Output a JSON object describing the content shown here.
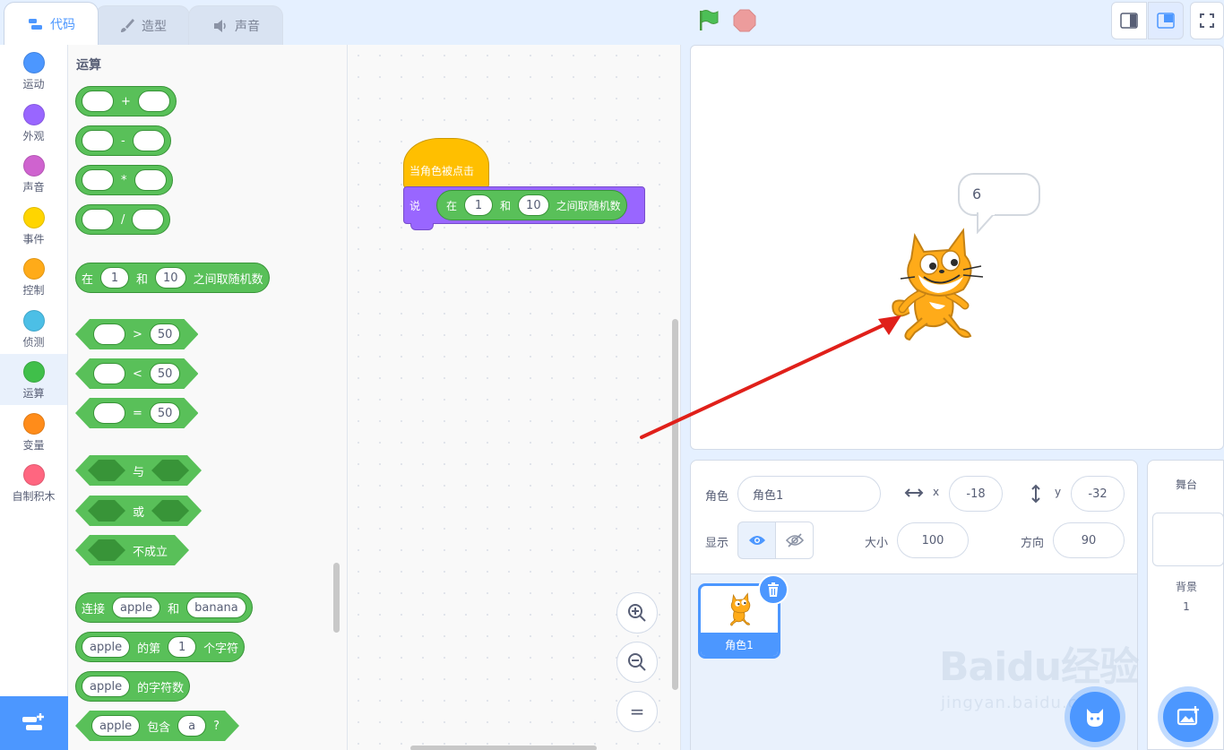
{
  "tabs": {
    "code": "代码",
    "costumes": "造型",
    "sounds": "声音"
  },
  "categories": [
    {
      "label": "运动",
      "color": "#4c97ff"
    },
    {
      "label": "外观",
      "color": "#9966ff"
    },
    {
      "label": "声音",
      "color": "#cf63cf"
    },
    {
      "label": "事件",
      "color": "#ffd500"
    },
    {
      "label": "控制",
      "color": "#ffab19"
    },
    {
      "label": "侦测",
      "color": "#4cbfe6"
    },
    {
      "label": "运算",
      "color": "#40bf4a"
    },
    {
      "label": "变量",
      "color": "#ff8c1a"
    },
    {
      "label": "自制积木",
      "color": "#ff6680"
    }
  ],
  "palette": {
    "title": "运算",
    "ops": [
      "+",
      "-",
      "*",
      "/"
    ],
    "random": {
      "p1": "在",
      "a": "1",
      "p2": "和",
      "b": "10",
      "p3": "之间取随机数"
    },
    "compare": [
      {
        "op": ">",
        "val": "50"
      },
      {
        "op": "<",
        "val": "50"
      },
      {
        "op": "=",
        "val": "50"
      }
    ],
    "logic": {
      "and": "与",
      "or": "或",
      "not": "不成立"
    },
    "join": {
      "p1": "连接",
      "a": "apple",
      "p2": "和",
      "b": "banana"
    },
    "letter": {
      "a": "apple",
      "p1": "的第",
      "n": "1",
      "p2": "个字符"
    },
    "length": {
      "a": "apple",
      "p1": "的字符数"
    },
    "contains": {
      "a": "apple",
      "p1": "包含",
      "b": "a",
      "p2": "?"
    }
  },
  "script": {
    "hat": "当角色被点击",
    "say": "说",
    "random": {
      "p1": "在",
      "a": "1",
      "p2": "和",
      "b": "10",
      "p3": "之间取随机数"
    }
  },
  "zoom": {
    "reset": "="
  },
  "stage": {
    "bubble": "6"
  },
  "sprite": {
    "label": "角色",
    "name": "角色1",
    "x_label": "x",
    "x": "-18",
    "y_label": "y",
    "y": "-32",
    "show_label": "显示",
    "size_label": "大小",
    "size": "100",
    "direction_label": "方向",
    "direction": "90",
    "thumb_name": "角色1"
  },
  "stage_pane": {
    "title": "舞台",
    "backdrop_label": "背景",
    "backdrop_count": "1"
  },
  "watermark": {
    "brand": "Baidu经验",
    "url": "jingyan.baidu.com"
  },
  "colors": {
    "accent": "#4c97ff",
    "operators": "#59c059",
    "events": "#ffbf00",
    "looks": "#9966ff"
  }
}
